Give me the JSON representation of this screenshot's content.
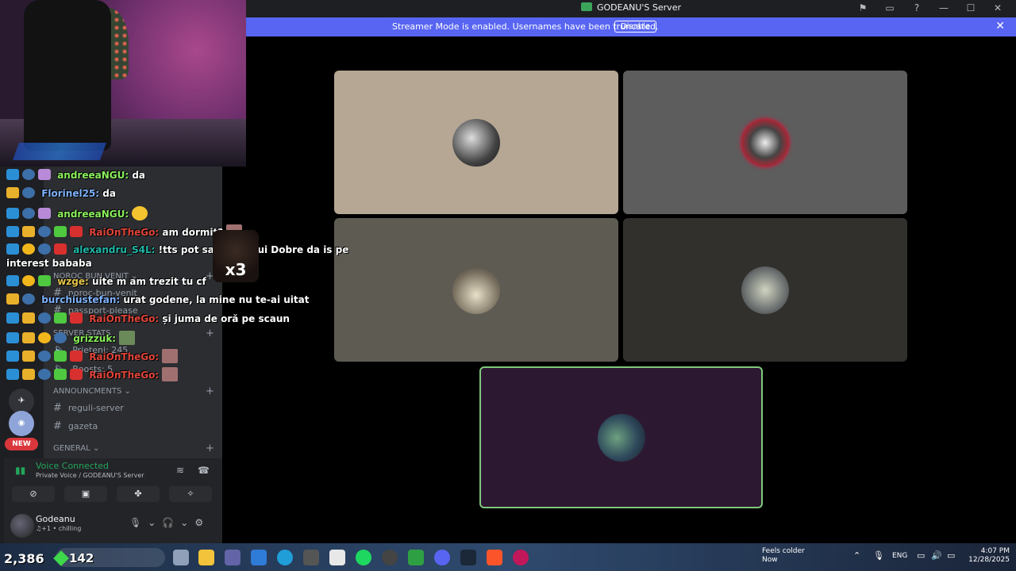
{
  "window": {
    "title": "GODEANU'S Server",
    "controls": [
      "—",
      "☐",
      "✕"
    ]
  },
  "banner": {
    "message": "Streamer Mode is enabled. Usernames have been truncated.",
    "button": "Disable",
    "close": "✕"
  },
  "sidebar": {
    "categories": [
      {
        "label": "NOROC BUN VENIT",
        "plus": "+"
      },
      {
        "label": "SERVER STATS",
        "plus": "+"
      },
      {
        "label": "ANNOUNCMENTS",
        "plus": "+"
      },
      {
        "label": "GENERAL",
        "plus": "+"
      }
    ],
    "channels": [
      {
        "label": "noroc-bun-venit"
      },
      {
        "label": "passport-please"
      },
      {
        "label": "Prieteni: 245"
      },
      {
        "label": "Boosts: 5"
      },
      {
        "label": "reguli-server"
      },
      {
        "label": "gazeta"
      }
    ],
    "new_badge": "NEW"
  },
  "voice": {
    "status": "Voice Connected",
    "location": "Private Voice / GODEANU'S Server"
  },
  "user": {
    "name": "Godeanu",
    "status": "♫+1 • chilling"
  },
  "chat": [
    {
      "user": "andreeaNGU:",
      "text": "da",
      "color": "green"
    },
    {
      "user": "Florinel25:",
      "text": "da",
      "color": "blue"
    },
    {
      "user": "andreeaNGU:",
      "text": "",
      "color": "green"
    },
    {
      "user": "RaiOnTheGo:",
      "text": "am dormit? ",
      "color": "red"
    },
    {
      "user": "alexandru_S4L:",
      "text": "!tts pot sa fi   asta lui Dobre da is pe",
      "color": "teal"
    },
    {
      "user": "",
      "text": "interest bababa",
      "color": ""
    },
    {
      "user": "wzge:",
      "text": "uite m am trezit tu cf",
      "color": "gold"
    },
    {
      "user": "burchiustefan:",
      "text": "urat godene, la mine nu te-ai uitat",
      "color": "blue"
    },
    {
      "user": "RaiOnTheGo:",
      "text": "și juma de oră pe scaun",
      "color": "red"
    },
    {
      "user": "grizzuk:",
      "text": "",
      "color": "green"
    },
    {
      "user": "RaiOnTheGo:",
      "text": "",
      "color": "red"
    },
    {
      "user": "RaiOnTheGo:",
      "text": "",
      "color": "red"
    }
  ],
  "emote_overlay": "x3",
  "stream_counters": {
    "primary": "2,386",
    "secondary": "142"
  },
  "taskbar": {
    "weather_title": "Feels colder",
    "weather_sub": "Now",
    "lang": "ENG",
    "time": "4:07 PM",
    "date": "12/28/2025"
  },
  "colors": {
    "banner": "#5865f2",
    "voice_green": "#23a55a",
    "speaking_border": "#7ec97a"
  }
}
